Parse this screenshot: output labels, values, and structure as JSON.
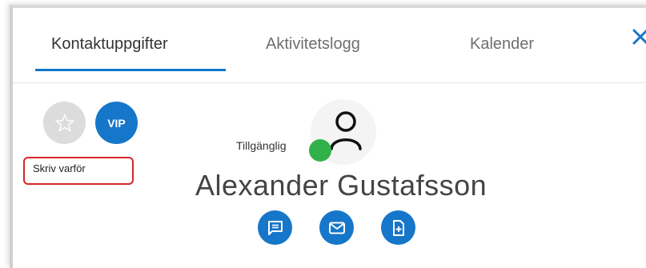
{
  "tabs": [
    {
      "label": "Kontaktuppgifter",
      "active": true
    },
    {
      "label": "Aktivitetslogg",
      "active": false
    },
    {
      "label": "Kalender",
      "active": false
    }
  ],
  "close": {
    "icon": "close-icon"
  },
  "favorite": {
    "icon": "star-outline-icon"
  },
  "vip": {
    "label": "VIP"
  },
  "reason": {
    "text": "Skriv varför"
  },
  "status": {
    "label": "Tillgänglig",
    "color": "#31b14a"
  },
  "contact": {
    "name": "Alexander Gustafsson",
    "avatar_icon": "person-icon"
  },
  "actions": [
    {
      "icon": "chat-icon"
    },
    {
      "icon": "mail-icon"
    },
    {
      "icon": "add-document-icon"
    }
  ],
  "colors": {
    "accent": "#1676c9",
    "highlight_border": "#d6262a",
    "tab_underline": "#1177cc"
  }
}
